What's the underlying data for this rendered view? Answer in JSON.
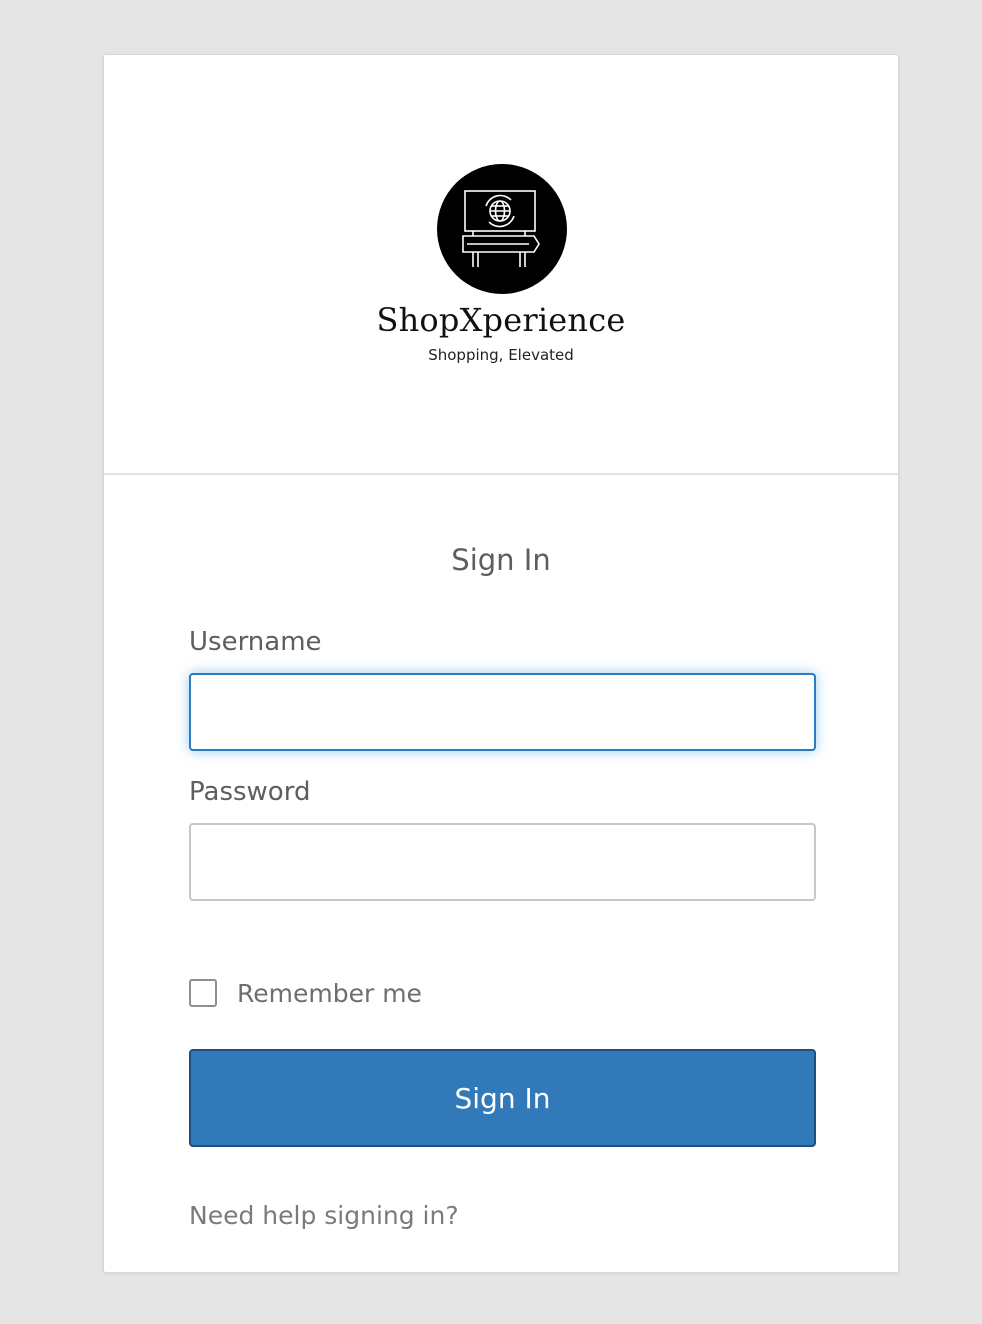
{
  "brand": {
    "name": "ShopXperience",
    "tagline": "Shopping, Elevated",
    "logo_icon": "billboard-globe-icon"
  },
  "form": {
    "title": "Sign In",
    "username_label": "Username",
    "username_value": "",
    "password_label": "Password",
    "password_value": "",
    "remember_label": "Remember me",
    "remember_checked": false,
    "submit_label": "Sign In",
    "help_link": "Need help signing in?"
  },
  "colors": {
    "background": "#e5e5e5",
    "primary_button": "#3279b9",
    "focus_ring": "#2d7bc0",
    "label_text": "#5e5e5e"
  }
}
